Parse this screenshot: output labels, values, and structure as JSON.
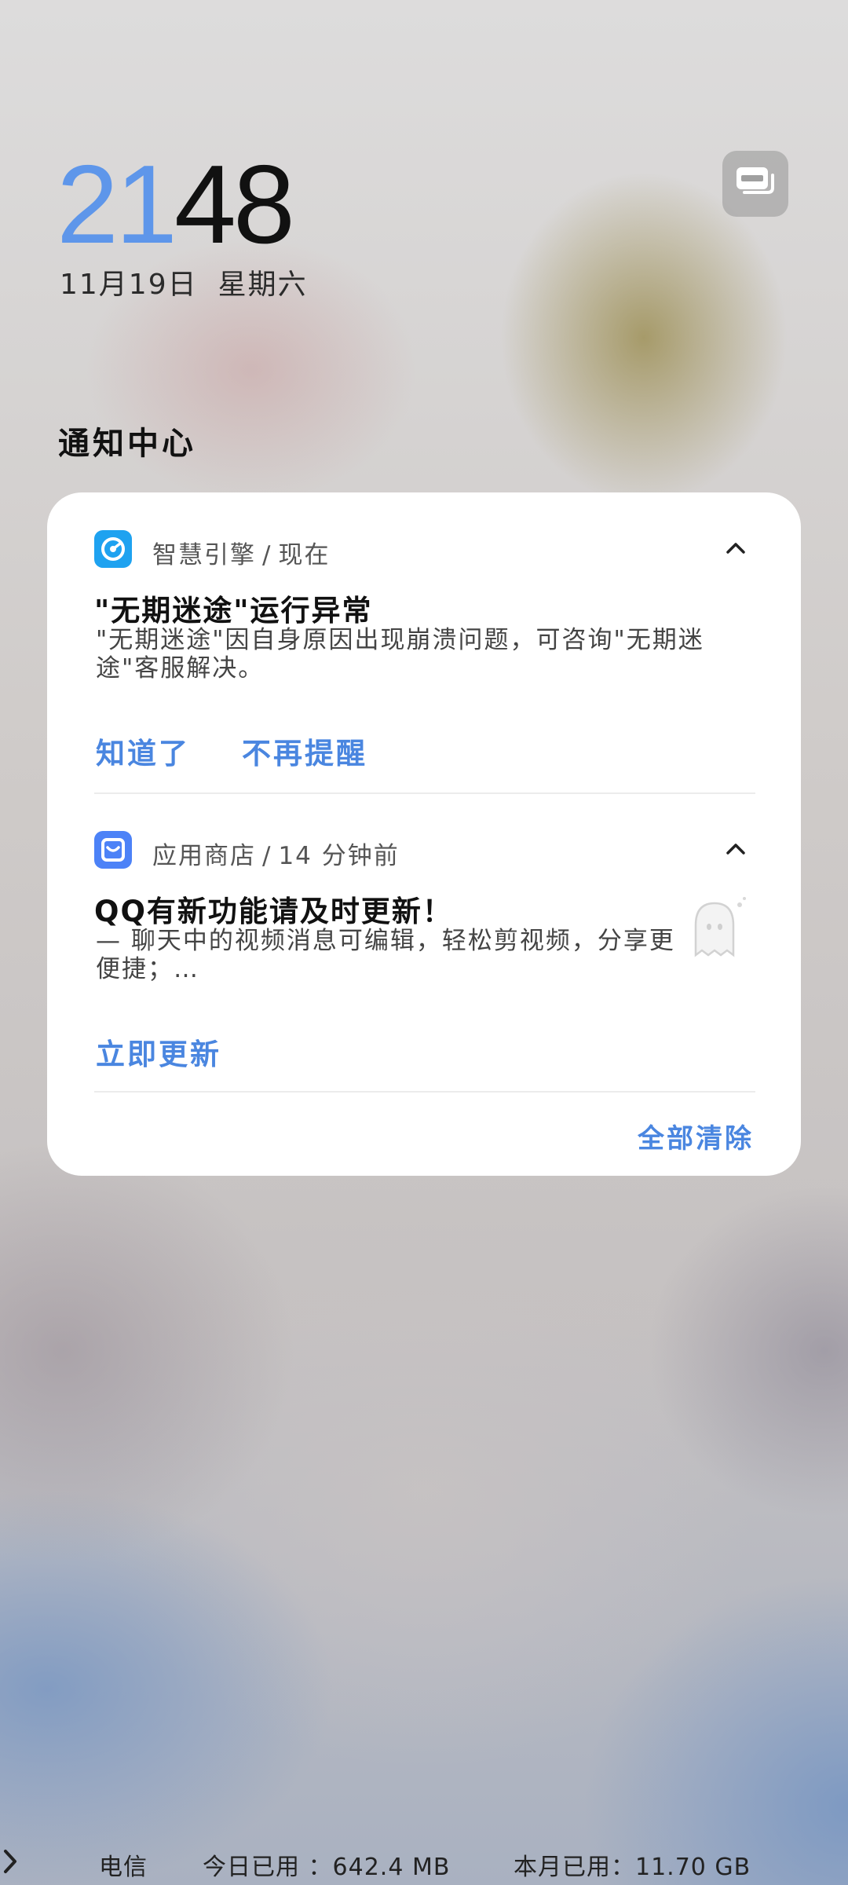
{
  "lockscreen": {
    "clock_hour": "21",
    "clock_minute": "48",
    "date": "11月19日",
    "weekday": "星期六",
    "notification_center_title": "通知中心"
  },
  "notifications": [
    {
      "app_name": "智慧引擎",
      "separator": "/",
      "time": "现在",
      "title": "\"无期迷途\"运行异常",
      "body": "\"无期迷途\"因自身原因出现崩溃问题，可咨询\"无期迷途\"客服解决。",
      "actions": [
        "知道了",
        "不再提醒"
      ],
      "icon": "engine-gauge-icon"
    },
    {
      "app_name": "应用商店",
      "separator": "/",
      "time": "14 分钟前",
      "title": "QQ有新功能请及时更新！",
      "body": "— 聊天中的视频消息可编辑，轻松剪视频，分享更便捷；…",
      "actions": [
        "立即更新"
      ],
      "icon": "shopping-bag-icon"
    }
  ],
  "clear_all_label": "全部清除",
  "data_usage": {
    "carrier": "电信",
    "today_label": "今日已用 ：642.4 MB",
    "month_label": "本月已用：11.70 GB"
  },
  "colors": {
    "accent": "#4a86e0",
    "clock_hour": "#5e96ea",
    "engine_icon_bg": "#1ea2f0",
    "store_icon_bg": "#4c82f7"
  }
}
